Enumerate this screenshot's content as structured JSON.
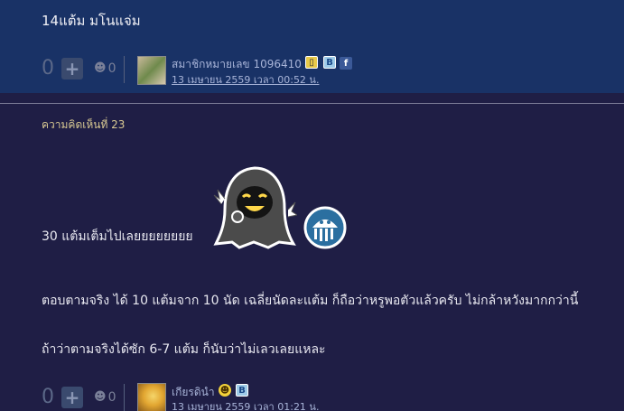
{
  "comment_top": {
    "text": "14แต้ม มโนแจ่ม",
    "votes": "0",
    "emotions": "0",
    "user": "สมาชิกหมายเลข 1096410",
    "date": "13 เมษายน 2559 เวลา 00:52 น."
  },
  "comment_23": {
    "number": "ความคิดเห็นที่ 23",
    "line1": "30 แต้มเต็มไปเลยยยยยยยย",
    "line2": "ตอบตามจริง ได้ 10 แต้มจาก 10 นัด เฉลี่ยนัดละแต้ม ก็ถือว่าหรูพอตัวแล้วครับ ไม่กล้าหวังมากกว่านี้",
    "line3": "ถ้าว่าตามจริงได้ซัก 6-7 แต้ม ก็นับว่าไม่เลวเลยแหละ",
    "votes": "0",
    "emotions": "0",
    "user": "เกียรดินำ",
    "date": "13 เมษายน 2559 เวลา 01:21 น."
  },
  "colors": {
    "top_bg": "#193266",
    "page_bg": "#1f1e45",
    "link": "#a8b4d8",
    "number": "#d7c892"
  },
  "icons": {
    "plus": "plus-icon",
    "emotion": "emotion-icon",
    "phone_badge": "phone-badge-icon",
    "blog_badge": "blog-badge-icon",
    "facebook_badge": "facebook-icon",
    "smile_badge": "smile-badge-icon"
  },
  "glyphs": {
    "plus": "+",
    "emotion": "☻",
    "phone": "▯",
    "blog": "B",
    "facebook": "f",
    "smile": "☻"
  }
}
